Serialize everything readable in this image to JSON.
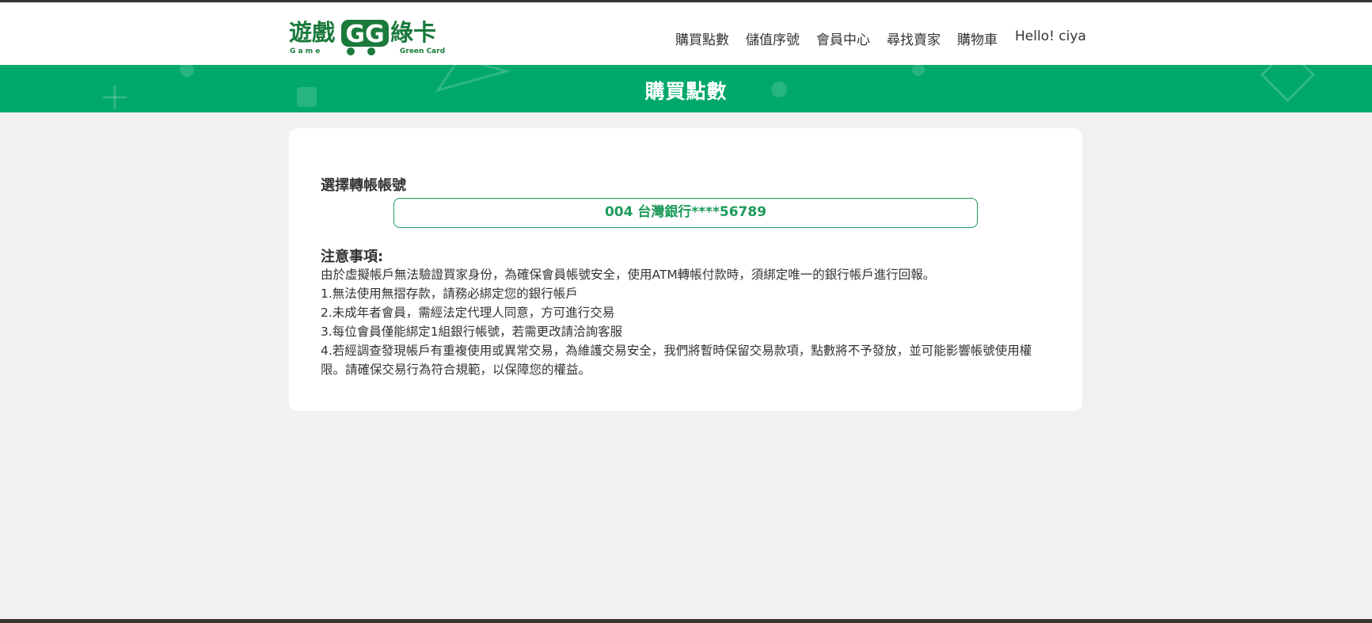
{
  "logo": {
    "main_left": "遊戲",
    "main_mid": "GG",
    "main_right": "綠卡",
    "sub_left": "G a m e",
    "sub_right": "Green Card"
  },
  "nav": {
    "items": [
      "購買點數",
      "儲值序號",
      "會員中心",
      "尋找賣家",
      "購物車"
    ],
    "greeting": "Hello! ciya"
  },
  "hero": {
    "title": "購買點數"
  },
  "account": {
    "label": "選擇轉帳帳號",
    "selected": "004 台灣銀行****56789"
  },
  "notice": {
    "title": "注意事項:",
    "intro": "由於虛擬帳戶無法驗證買家身份，為確保會員帳號安全，使用ATM轉帳付款時，須綁定唯一的銀行帳戶進行回報。",
    "items": [
      "1.無法使用無摺存款，請務必綁定您的銀行帳戶",
      "2.未成年者會員，需經法定代理人同意，方可進行交易",
      "3.每位會員僅能綁定1組銀行帳號，若需更改請洽詢客服",
      "4.若經調查發現帳戶有重複使用或異常交易，為維護交易安全，我們將暫時保留交易款項，點數將不予發放，並可能影響帳號使用權限。請確保交易行為符合規範，以保障您的權益。"
    ]
  },
  "colors": {
    "brand_green": "#00a96b",
    "logo_green": "#1a7a3c",
    "accent_green": "#1d9b5a"
  }
}
